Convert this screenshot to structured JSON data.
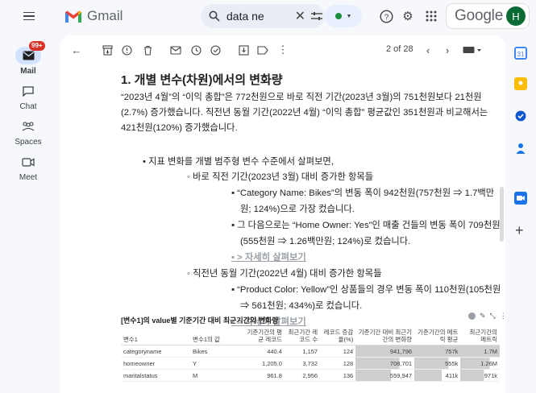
{
  "app": {
    "name": "Gmail"
  },
  "search": {
    "value": "data ne"
  },
  "account": {
    "brand": "Google",
    "initial": "H"
  },
  "leftnav": {
    "badge": "99+",
    "items": [
      {
        "label": "Mail"
      },
      {
        "label": "Chat"
      },
      {
        "label": "Spaces"
      },
      {
        "label": "Meet"
      }
    ]
  },
  "toolbar": {
    "pager": "2 of 28"
  },
  "email": {
    "heading": "1. 개별 변수(차원)에서의 변화량",
    "para": "“2023년 4월”의 “이익 총합”은 772천원으로 바로 직전 기간(2023년 3월)의 751천원보다 21천원 (2.7%) 증가했습니다. 직전년 동월 기간(2022년 4월) “이익 총합” 평균값인 351천원과 비교해서는 421천원(120%) 증가했습니다.",
    "lines": [
      "• 지표 변화를 개별 범주형 변수 수준에서 살펴보면,",
      "◦ 바로 직전 기간(2023년 3월) 대비 증가한 항목들",
      "▪ “Category Name: Bikes”의 변동 폭이 942천원(757천원 ⇒ 1.7백만",
      "원; 124%)으로 가장 컸습니다.",
      "▪ 그 다음으로는 “Home Owner: Yes”인 매출 건들의 변동 폭이 709천원",
      "(555천원 ⇒ 1.26백만원; 124%)로 컸습니다.",
      "▪ > 자세히 살펴보기",
      "◦ 직전년 동월 기간(2022년 4월) 대비 증가한 항목들",
      "▪ “Product Color: Yellow”인 상품들의 경우 변동 폭이 110천원(105천원",
      "⇒ 561천원; 434%)로 컸습니다.",
      "▪ > 자세히 살펴보기"
    ]
  },
  "table": {
    "title": "[변수1]의 value별 기준기간 대비 최근기간의 변화량",
    "headers": [
      "변수1",
      "변수1의 값",
      "기준기간의 평균 레코드",
      "최근기간 레코드 수",
      "레코드 증감율(%)",
      "기준기간 대비 최근기간의 변화량",
      "기준기간의 메트릭 평균",
      "최근기간의 메트릭"
    ],
    "rows": [
      [
        "categoryname",
        "Bikes",
        "440.4",
        "1,157",
        "124",
        "941,796",
        "757k",
        "1.7M"
      ],
      [
        "homeowner",
        "Y",
        "1,205.0",
        "3,732",
        "128",
        "708,701",
        "555k",
        "1.26M"
      ],
      [
        "maritalstatus",
        "M",
        "961.8",
        "2,956",
        "136",
        "559,947",
        "411k",
        "971k"
      ]
    ],
    "bar_fraction": [
      1.0,
      0.75,
      0.6
    ]
  },
  "colors": {
    "gmail_red": "#ea4335",
    "accent_blue": "#0b57d0",
    "badge": "#d93025",
    "avatar": "#0b6b35"
  }
}
